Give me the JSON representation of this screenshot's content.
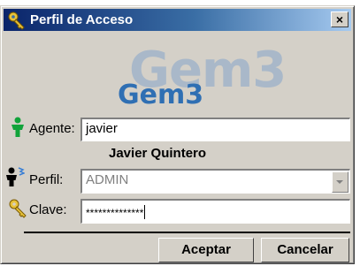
{
  "window": {
    "title": "Perfil de Acceso",
    "close_symbol": "×",
    "title_icon": "keys-icon"
  },
  "logo": {
    "big_text": "Gem3",
    "small_text": "Gem3"
  },
  "form": {
    "agente": {
      "label": "Agente:",
      "value": "javier",
      "icon": "agent-icon"
    },
    "full_name": "Javier Quintero",
    "perfil": {
      "label": "Perfil:",
      "value": "ADMIN",
      "icon": "profile-icon",
      "enabled": false
    },
    "clave": {
      "label": "Clave:",
      "value": "**************",
      "icon": "key-icon"
    }
  },
  "buttons": {
    "accept": "Aceptar",
    "cancel": "Cancelar"
  },
  "colors": {
    "title_gradient_start": "#0a246a",
    "title_gradient_end": "#a6caf0",
    "dialog_face": "#d4d0c8",
    "logo_light": "#a9b8c9",
    "logo_dark": "#2f6fb3"
  }
}
